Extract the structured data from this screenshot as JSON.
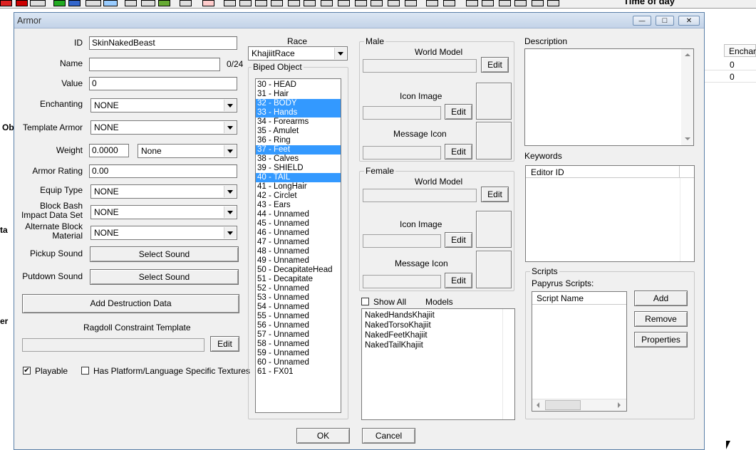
{
  "background": {
    "time_of_day": "Time of day",
    "side_labels": [
      "Ob",
      "ta",
      "er"
    ],
    "grid_header": "Enchan",
    "grid_values": [
      "0",
      "0"
    ]
  },
  "window": {
    "title": "Armor",
    "minimize": "—",
    "maximize": "□",
    "close": "✕"
  },
  "form": {
    "id_label": "ID",
    "id_value": "SkinNakedBeast",
    "name_label": "Name",
    "name_value": "",
    "name_counter": "0/24",
    "value_label": "Value",
    "value_value": "0",
    "enchanting_label": "Enchanting",
    "enchanting_value": "NONE",
    "template_label": "Template Armor",
    "template_value": "NONE",
    "weight_label": "Weight",
    "weight_value": "0.0000",
    "weight_type": "None",
    "armor_rating_label": "Armor Rating",
    "armor_rating_value": "0.00",
    "equip_type_label": "Equip Type",
    "equip_type_value": "NONE",
    "block_bash_label_1": "Block Bash",
    "block_bash_label_2": "Impact Data Set",
    "block_bash_value": "NONE",
    "alt_block_label_1": "Alternate Block",
    "alt_block_label_2": "Material",
    "alt_block_value": "NONE",
    "pickup_label": "Pickup Sound",
    "pickup_button": "Select Sound",
    "putdown_label": "Putdown Sound",
    "putdown_button": "Select Sound",
    "destruction_button": "Add Destruction Data",
    "ragdoll_label": "Ragdoll Constraint Template",
    "ragdoll_edit": "Edit",
    "playable_label": "Playable",
    "playable_check": "✔",
    "platform_label": "Has Platform/Language Specific Textures"
  },
  "race": {
    "label": "Race",
    "value": "KhajiitRace",
    "biped_label": "Biped Object",
    "slots": [
      {
        "t": "30 - HEAD",
        "s": false
      },
      {
        "t": "31 - Hair",
        "s": false
      },
      {
        "t": "32 - BODY",
        "s": true
      },
      {
        "t": "33 - Hands",
        "s": true
      },
      {
        "t": "34 - Forearms",
        "s": false
      },
      {
        "t": "35 - Amulet",
        "s": false
      },
      {
        "t": "36 - Ring",
        "s": false
      },
      {
        "t": "37 - Feet",
        "s": true
      },
      {
        "t": "38 - Calves",
        "s": false
      },
      {
        "t": "39 - SHIELD",
        "s": false
      },
      {
        "t": "40 - TAIL",
        "s": true
      },
      {
        "t": "41 - LongHair",
        "s": false
      },
      {
        "t": "42 - Circlet",
        "s": false
      },
      {
        "t": "43 - Ears",
        "s": false
      },
      {
        "t": "44 - Unnamed",
        "s": false
      },
      {
        "t": "45 - Unnamed",
        "s": false
      },
      {
        "t": "46 - Unnamed",
        "s": false
      },
      {
        "t": "47 - Unnamed",
        "s": false
      },
      {
        "t": "48 - Unnamed",
        "s": false
      },
      {
        "t": "49 - Unnamed",
        "s": false
      },
      {
        "t": "50 - DecapitateHead",
        "s": false
      },
      {
        "t": "51 - Decapitate",
        "s": false
      },
      {
        "t": "52 - Unnamed",
        "s": false
      },
      {
        "t": "53 - Unnamed",
        "s": false
      },
      {
        "t": "54 - Unnamed",
        "s": false
      },
      {
        "t": "55 - Unnamed",
        "s": false
      },
      {
        "t": "56 - Unnamed",
        "s": false
      },
      {
        "t": "57 - Unnamed",
        "s": false
      },
      {
        "t": "58 - Unnamed",
        "s": false
      },
      {
        "t": "59 - Unnamed",
        "s": false
      },
      {
        "t": "60 - Unnamed",
        "s": false
      },
      {
        "t": "61 - FX01",
        "s": false
      }
    ]
  },
  "male": {
    "label": "Male",
    "world_model": "World Model",
    "world_edit": "Edit",
    "icon_image": "Icon Image",
    "icon_edit": "Edit",
    "message_icon": "Message Icon",
    "message_edit": "Edit"
  },
  "female": {
    "label": "Female",
    "world_model": "World Model",
    "world_edit": "Edit",
    "icon_image": "Icon Image",
    "icon_edit": "Edit",
    "message_icon": "Message Icon",
    "message_edit": "Edit"
  },
  "models": {
    "show_all": "Show All",
    "label": "Models",
    "items": [
      "NakedHandsKhajiit",
      "NakedTorsoKhajiit",
      "NakedFeetKhajiit",
      "NakedTailKhajiit"
    ]
  },
  "description": {
    "label": "Description"
  },
  "keywords": {
    "label": "Keywords",
    "column": "Editor ID"
  },
  "scripts": {
    "label": "Scripts",
    "papyrus_label": "Papyrus Scripts:",
    "column": "Script Name",
    "add": "Add",
    "remove": "Remove",
    "properties": "Properties"
  },
  "footer": {
    "ok": "OK",
    "cancel": "Cancel"
  }
}
